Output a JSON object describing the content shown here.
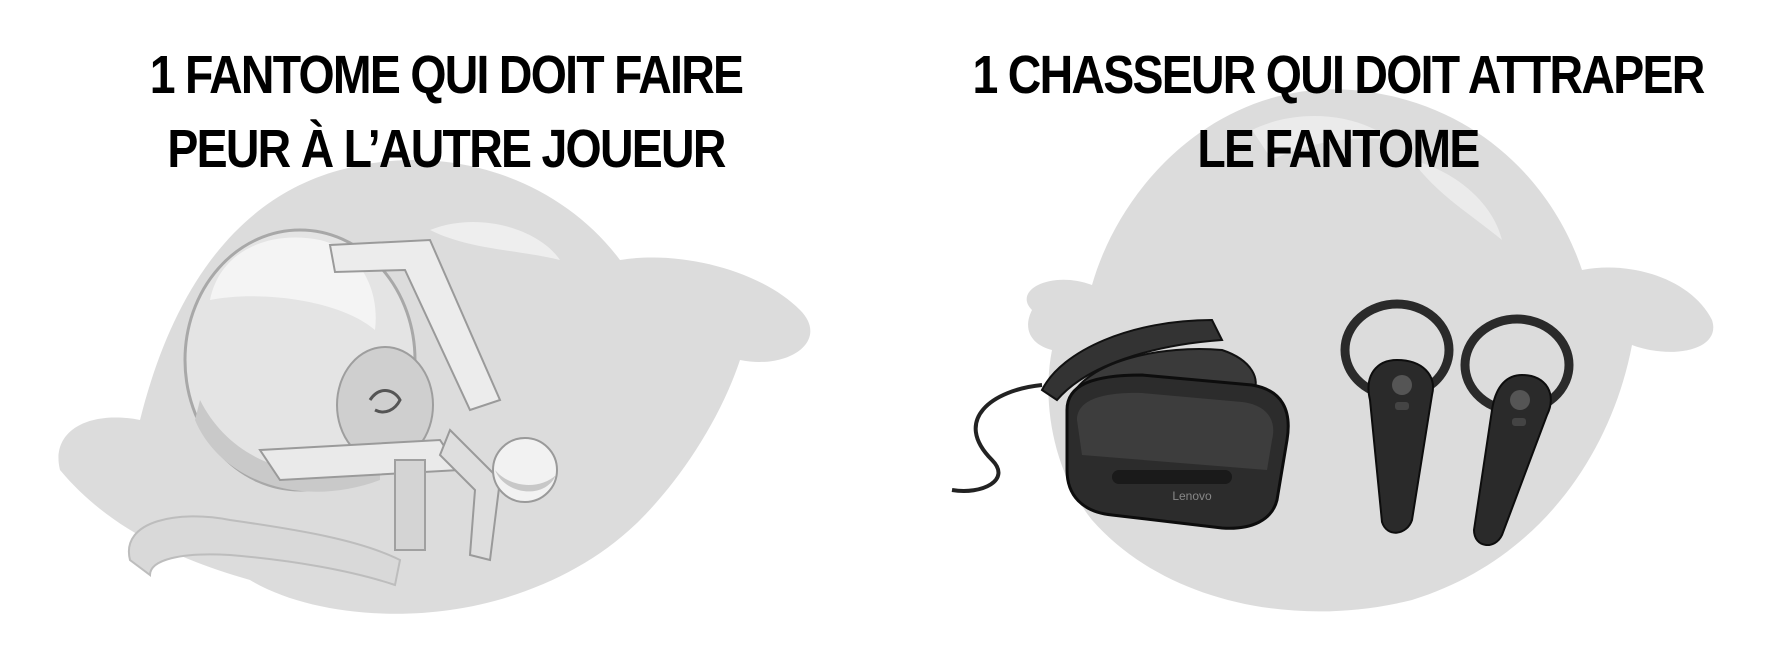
{
  "left_panel": {
    "heading_line1": "1 FANTOME QUI DOIT FAIRE",
    "heading_line2": "PEUR À L’AUTRE JOUEUR",
    "image_icon": "haptic-device-icon"
  },
  "right_panel": {
    "heading_line1": "1 CHASSEUR QUI DOIT ATTRAPER",
    "heading_line2": "LE FANTOME",
    "headset_brand": "Lenovo",
    "image_icon": "vr-headset-controllers-icon"
  },
  "colors": {
    "text": "#000000",
    "ghost_silhouette": "#dcdcdc",
    "device_dark": "#2a2a2a",
    "device_light": "#e6e6e6"
  }
}
